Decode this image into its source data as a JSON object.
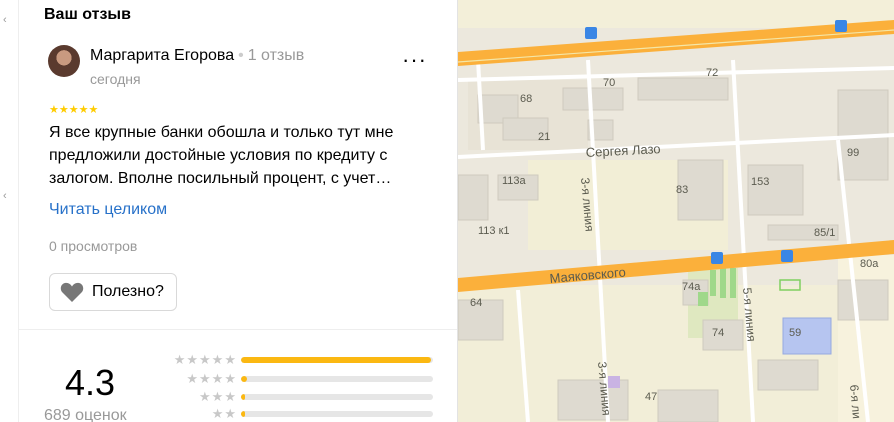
{
  "section_title": "Ваш отзыв",
  "review": {
    "author": "Маргарита Егорова",
    "separator": "•",
    "author_reviews": "1 отзыв",
    "date": "сегодня",
    "stars": "★★★★★",
    "text": "Я все крупные банки обошла и только тут мне предложили достойные условия по кредиту с залогом. Вполне посильный процент, с учет…",
    "read_more": "Читать целиком",
    "views": "0 просмотров",
    "useful_label": "Полезно?",
    "more_icon": "ellipsis-icon"
  },
  "rating": {
    "average": "4.3",
    "count": "689 оценок",
    "rows": [
      {
        "stars": "★★★★★",
        "share": 0.99
      },
      {
        "stars": "★★★★",
        "share": 0.03
      },
      {
        "stars": "★★★",
        "share": 0.02
      },
      {
        "stars": "★★",
        "share": 0.02
      }
    ],
    "accent": "#fbb812"
  },
  "map": {
    "streets": [
      "Сергея Лазо",
      "Маяковского",
      "3-я линия",
      "5-я линия",
      "6-я ли"
    ],
    "buildings": [
      "68",
      "70",
      "72",
      "21",
      "113а",
      "83",
      "153",
      "99",
      "113 к1",
      "85/1",
      "80а",
      "64",
      "74а",
      "74",
      "59",
      "47"
    ]
  }
}
